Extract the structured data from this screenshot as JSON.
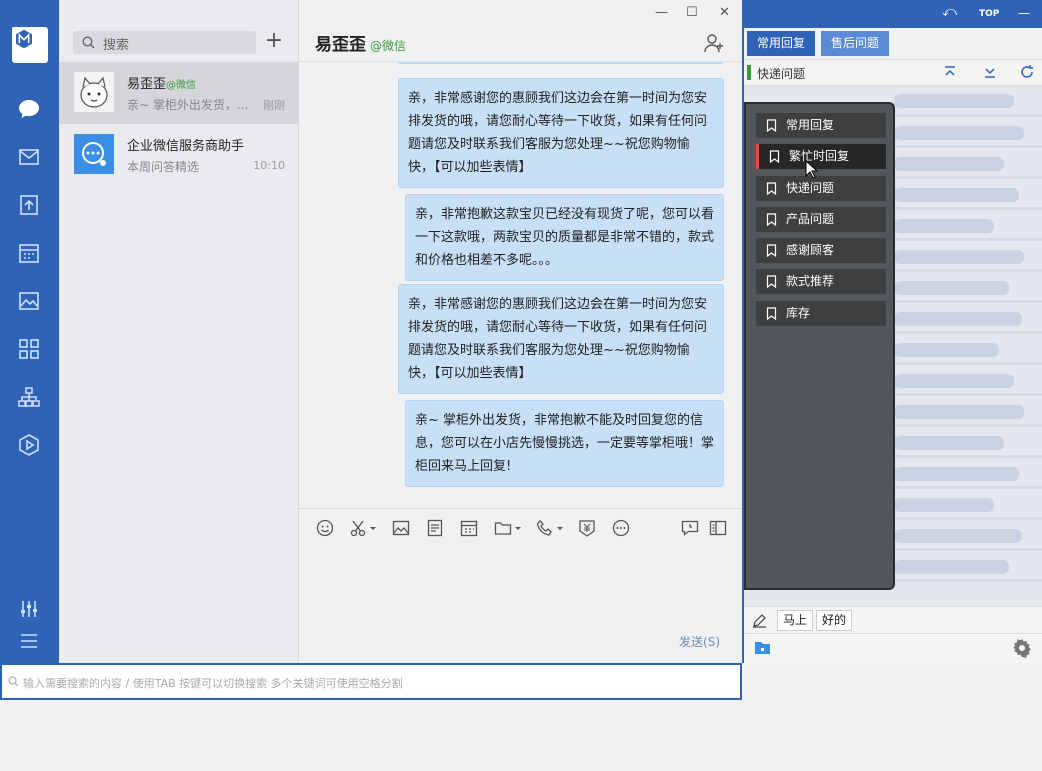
{
  "sidebar": {
    "icons": [
      "logo-icon",
      "chat-icon",
      "mail-icon",
      "docs-icon",
      "calendar-icon",
      "photo-icon",
      "apps-icon",
      "org-icon",
      "video-icon",
      "settings-sliders-icon",
      "menu-icon"
    ]
  },
  "contacts": {
    "search_placeholder": "搜索",
    "items": [
      {
        "name": "易歪歪",
        "tag": "@微信",
        "preview": "亲~ 掌柜外出发货，...",
        "time": "刚刚"
      },
      {
        "name": "企业微信服务商助手",
        "tag": "",
        "preview": "本周问答精选",
        "time": "10:10"
      }
    ]
  },
  "chat": {
    "title": "易歪歪",
    "title_tag": "@微信",
    "window_controls": {
      "minimize": "—",
      "maximize": "☐",
      "close": "✕"
    },
    "messages": [
      {
        "text": "亲，非常感谢您的惠顾我们这边会在第一时间为您安排发货的哦，请您耐心等待一下收货，如果有任何问题请您及时联系我们客服为您处理~~祝您购物愉快，【可以加些表情】"
      },
      {
        "text": "亲，非常抱歉这款宝贝已经没有现货了呢，您可以看一下这款哦，两款宝贝的质量都是非常不错的，款式和价格也相差不多呢。。。"
      },
      {
        "text": "亲，非常感谢您的惠顾我们这边会在第一时间为您安排发货的哦，请您耐心等待一下收货，如果有任何问题请您及时联系我们客服为您处理~~祝您购物愉快，【可以加些表情】"
      },
      {
        "text": "亲~ 掌柜外出发货，非常抱歉不能及时回复您的信息，您可以在小店先慢慢挑选，一定要等掌柜哦！掌柜回来马上回复!"
      }
    ],
    "send_label": "发送(S)"
  },
  "bottom_search": {
    "placeholder": "输入需要搜索的内容 / 使用TAB 按键可以切换搜索 多个关键词可使用空格分割"
  },
  "quick_reply": {
    "top_controls": {
      "back": "⤺",
      "top": "TOP",
      "minimize": "—"
    },
    "tabs": [
      "常用回复",
      "售后问题"
    ],
    "category": "快递问题",
    "menu_items": [
      {
        "label": "常用回复",
        "selected": false
      },
      {
        "label": "繁忙时回复",
        "selected": true
      },
      {
        "label": "快递问题",
        "selected": false
      },
      {
        "label": "产品问题",
        "selected": false
      },
      {
        "label": "感谢顾客",
        "selected": false
      },
      {
        "label": "款式推荐",
        "selected": false
      },
      {
        "label": "库存",
        "selected": false
      }
    ],
    "chips": [
      "马上",
      "好的"
    ]
  }
}
